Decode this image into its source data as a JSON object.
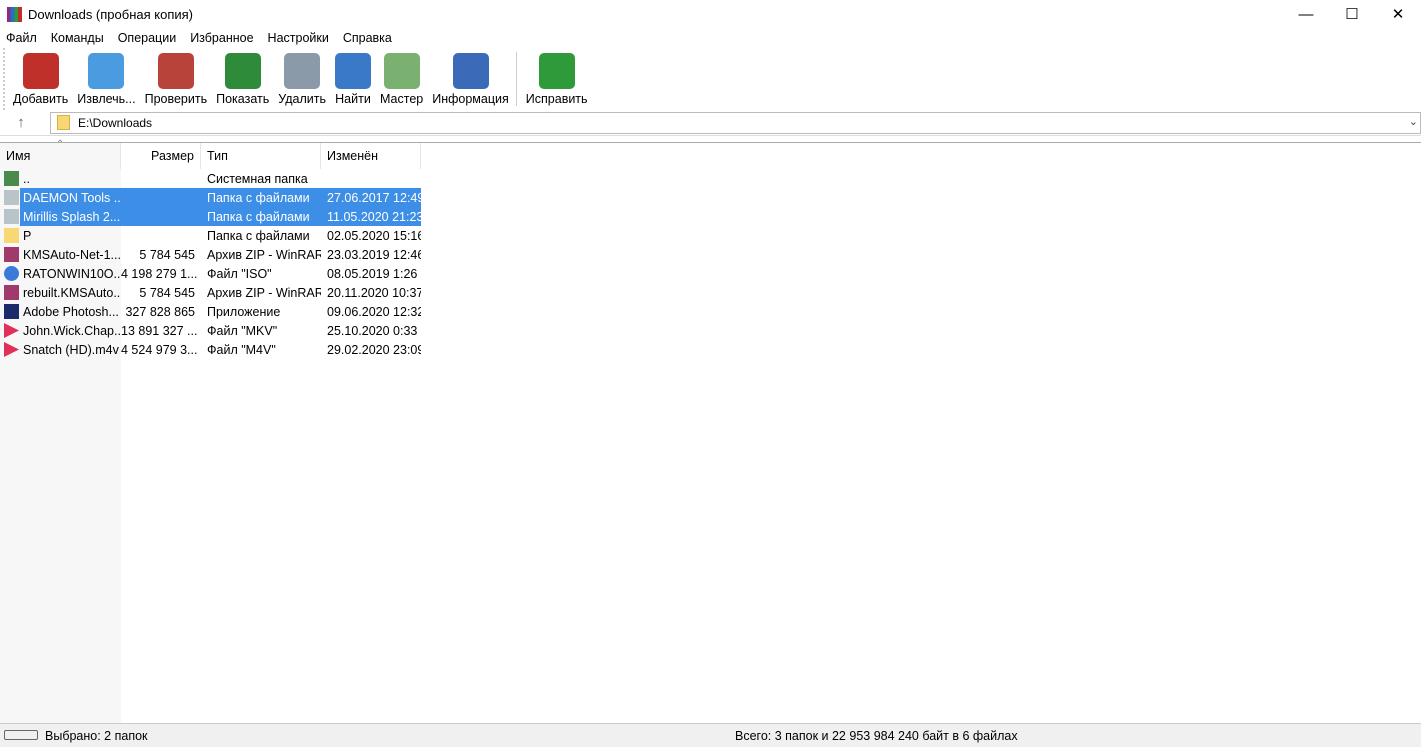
{
  "window": {
    "title": "Downloads (пробная копия)"
  },
  "menu": [
    "Файл",
    "Команды",
    "Операции",
    "Избранное",
    "Настройки",
    "Справка"
  ],
  "toolbar": [
    {
      "label": "Добавить",
      "icon": "archive-add-icon",
      "color": "#c0302a"
    },
    {
      "label": "Извлечь...",
      "icon": "extract-folder-icon",
      "color": "#4a9be0"
    },
    {
      "label": "Проверить",
      "icon": "test-clipboard-icon",
      "color": "#b8433a"
    },
    {
      "label": "Показать",
      "icon": "view-book-icon",
      "color": "#2e8b3a"
    },
    {
      "label": "Удалить",
      "icon": "trash-icon",
      "color": "#8a9aa8"
    },
    {
      "label": "Найти",
      "icon": "search-icon",
      "color": "#3a78c8"
    },
    {
      "label": "Мастер",
      "icon": "wizard-wand-icon",
      "color": "#7ab070"
    },
    {
      "label": "Информация",
      "icon": "info-icon",
      "color": "#3a6ab8"
    }
  ],
  "toolbar_extra": {
    "label": "Исправить",
    "icon": "repair-icon",
    "color": "#2e9a3a"
  },
  "address": {
    "path": "E:\\Downloads"
  },
  "columns": {
    "name": "Имя",
    "size": "Размер",
    "type": "Тип",
    "modified": "Изменён"
  },
  "files": [
    {
      "name": "..",
      "size": "",
      "type": "Системная папка",
      "modified": "",
      "icon": "parent-folder-icon",
      "color": "#4a8a4a",
      "selected": false
    },
    {
      "name": "DAEMON Tools ...",
      "size": "",
      "type": "Папка с файлами",
      "modified": "27.06.2017 12:49",
      "icon": "folder-icon",
      "color": "#b8c4c8",
      "selected": true
    },
    {
      "name": "Mirillis Splash 2....",
      "size": "",
      "type": "Папка с файлами",
      "modified": "11.05.2020 21:23",
      "icon": "folder-icon",
      "color": "#b8c4c8",
      "selected": true
    },
    {
      "name": "P",
      "size": "",
      "type": "Папка с файлами",
      "modified": "02.05.2020 15:16",
      "icon": "folder-icon",
      "color": "#f8d775",
      "selected": false
    },
    {
      "name": "KMSAuto-Net-1...",
      "size": "5 784 545",
      "type": "Архив ZIP - WinRAR",
      "modified": "23.03.2019 12:46",
      "icon": "winrar-archive-icon",
      "color": "#a03a6a",
      "selected": false
    },
    {
      "name": "RATONWIN10O...",
      "size": "4 198 279 1...",
      "type": "Файл \"ISO\"",
      "modified": "08.05.2019 1:26",
      "icon": "iso-disc-icon",
      "color": "#3a7ad8",
      "selected": false
    },
    {
      "name": "rebuilt.KMSAuto...",
      "size": "5 784 545",
      "type": "Архив ZIP - WinRAR",
      "modified": "20.11.2020 10:37",
      "icon": "winrar-archive-icon",
      "color": "#a03a6a",
      "selected": false
    },
    {
      "name": "Adobe Photosh...",
      "size": "327 828 865",
      "type": "Приложение",
      "modified": "09.06.2020 12:32",
      "icon": "photoshop-icon",
      "color": "#1a2a6a",
      "selected": false
    },
    {
      "name": "John.Wick.Chap...",
      "size": "13 891 327 ...",
      "type": "Файл \"MKV\"",
      "modified": "25.10.2020 0:33",
      "icon": "video-play-icon",
      "color": "#e0305a",
      "selected": false
    },
    {
      "name": "Snatch (HD).m4v",
      "size": "4 524 979 3...",
      "type": "Файл \"M4V\"",
      "modified": "29.02.2020 23:09",
      "icon": "video-play-icon",
      "color": "#e0305a",
      "selected": false
    }
  ],
  "status": {
    "selected": "Выбрано: 2 папок",
    "total": "Всего: 3 папок и 22 953 984 240 байт в 6 файлах"
  }
}
